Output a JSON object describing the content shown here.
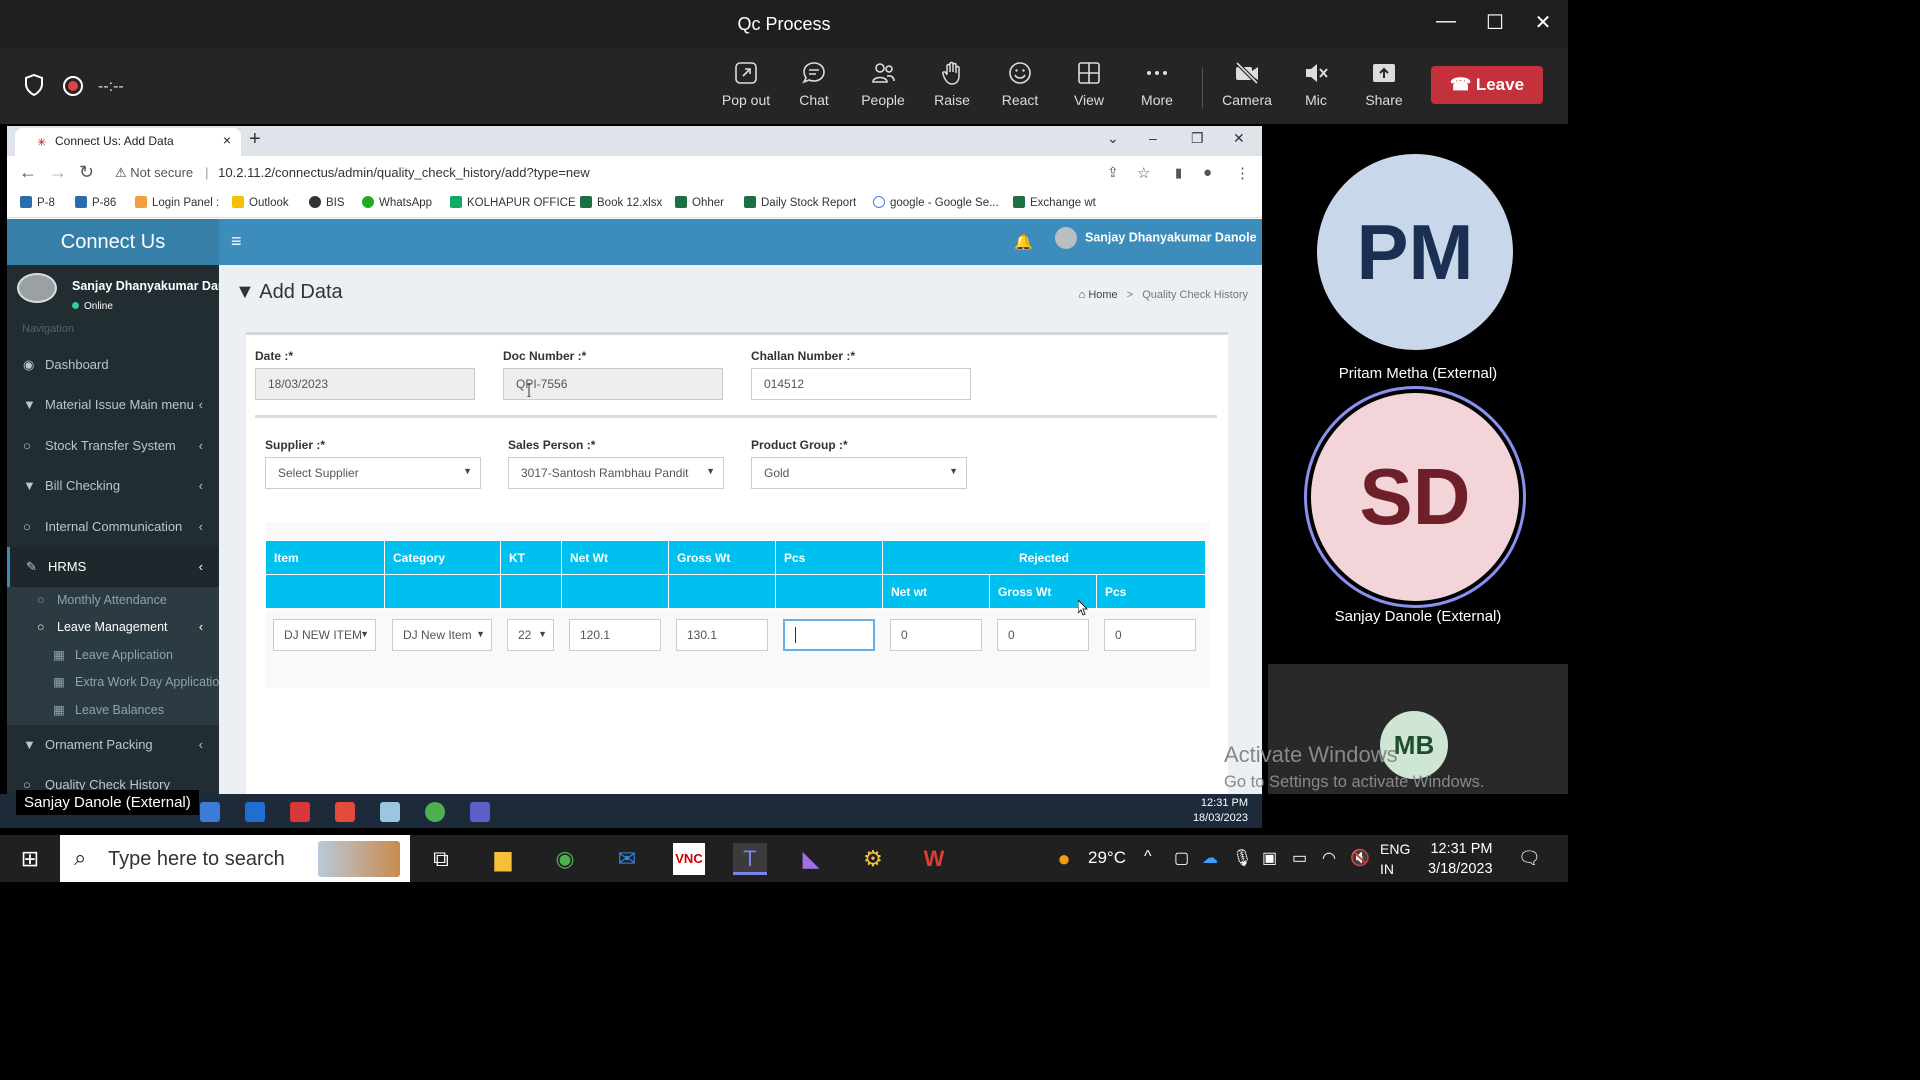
{
  "window": {
    "title": "Qc Process"
  },
  "meeting": {
    "timer": "--:--",
    "buttons": {
      "popout": "Pop out",
      "chat": "Chat",
      "people": "People",
      "raise": "Raise",
      "react": "React",
      "view": "View",
      "more": "More",
      "camera": "Camera",
      "mic": "Mic",
      "share": "Share"
    },
    "leave": "Leave"
  },
  "browser": {
    "tab_title": "Connect Us: Add Data",
    "not_secure": "Not secure",
    "url": "10.2.11.2/connectus/admin/quality_check_history/add?type=new",
    "bookmarks": [
      "P-8",
      "P-86",
      "Login Panel :",
      "Outlook",
      "BIS",
      "WhatsApp",
      "KOLHAPUR OFFICE",
      "Book 12.xlsx",
      "Ohher",
      "Daily Stock Report",
      "google - Google Se...",
      "Exchange wt"
    ]
  },
  "app": {
    "brand": "Connect Us",
    "user": {
      "name": "Sanjay Dhanyakumar Danole",
      "status": "Online"
    },
    "nav_heading": "Navigation",
    "nav": [
      "Dashboard",
      "Material Issue Main menu",
      "Stock Transfer System",
      "Bill Checking",
      "Internal Communication",
      "HRMS"
    ],
    "hrms_sub": [
      "Monthly Attendance",
      "Leave Management"
    ],
    "leave_sub": [
      "Leave Application",
      "Extra Work Day Application",
      "Leave Balances"
    ],
    "nav_after": [
      "Ornament Packing",
      "Quality Check History"
    ],
    "page_title": "Add Data",
    "breadcrumb": {
      "home": "Home",
      "current": "Quality Check History"
    },
    "form": {
      "date_label": "Date :*",
      "date_value": "18/03/2023",
      "doc_label": "Doc Number :*",
      "doc_value": "QPI-7556",
      "challan_label": "Challan Number :*",
      "challan_value": "014512",
      "supplier_label": "Supplier :*",
      "supplier_value": "Select Supplier",
      "sales_label": "Sales Person :*",
      "sales_value": "3017-Santosh Rambhau Pandit",
      "group_label": "Product Group :*",
      "group_value": "Gold"
    },
    "table": {
      "headers": [
        "Item",
        "Category",
        "KT",
        "Net Wt",
        "Gross Wt",
        "Pcs",
        "Rejected"
      ],
      "rejected_sub": [
        "Net wt",
        "Gross Wt",
        "Pcs"
      ],
      "row": {
        "item": "DJ NEW ITEM",
        "category": "DJ New Item",
        "kt": "22",
        "net_wt": "120.1",
        "gross_wt": "130.1",
        "pcs": "",
        "rej_net": "0",
        "rej_gross": "0",
        "rej_pcs": "0"
      }
    }
  },
  "participants": [
    {
      "initials": "PM",
      "name": "Pritam Metha (External)"
    },
    {
      "initials": "SD",
      "name": "Sanjay Danole (External)"
    },
    {
      "initials": "MB"
    }
  ],
  "watermark": {
    "line1": "Activate Windows",
    "line2": "Go to Settings to activate Windows."
  },
  "inner_taskbar": {
    "caption": "Sanjay Danole (External)",
    "time": "12:31 PM",
    "date": "18/03/2023"
  },
  "taskbar": {
    "search_placeholder": "Type here to search",
    "weather": "29°C",
    "lang1": "ENG",
    "lang2": "IN",
    "time": "12:31 PM",
    "date": "3/18/2023"
  },
  "colors": {
    "brand": "#3c8dbc",
    "table_header": "#00c0ef",
    "leave": "#c4313b"
  }
}
